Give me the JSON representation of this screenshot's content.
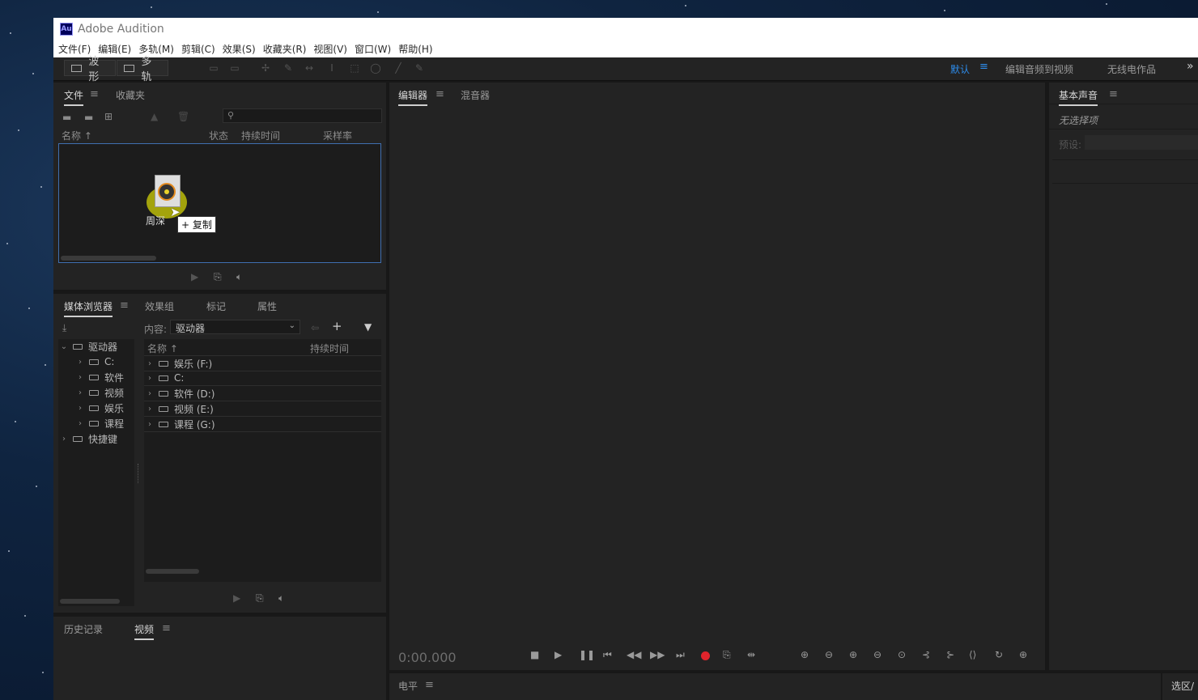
{
  "app": {
    "logo": "Au",
    "title": "Adobe Audition"
  },
  "menu": [
    "文件(F)",
    "编辑(E)",
    "多轨(M)",
    "剪辑(C)",
    "效果(S)",
    "收藏夹(R)",
    "视图(V)",
    "窗口(W)",
    "帮助(H)"
  ],
  "toolbar": {
    "waveform_label": "波形",
    "multitrack_label": "多轨"
  },
  "workspaces": {
    "default": "默认",
    "edit_audio_to_video": "编辑音频到视频",
    "radio": "无线电作品",
    "more": "»"
  },
  "files_panel": {
    "tabs": [
      "文件",
      "收藏夹"
    ],
    "columns": {
      "name": "名称 ↑",
      "status": "状态",
      "duration": "持续时间",
      "sample_rate": "采样率"
    },
    "dragged_file_label": "周深",
    "copy_tooltip": "+ 复制"
  },
  "media_panel": {
    "tabs": [
      "媒体浏览器",
      "效果组",
      "标记",
      "属性"
    ],
    "content_label": "内容:",
    "content_value": "驱动器",
    "tree": {
      "root": "驱动器",
      "items": [
        "C:",
        "软件",
        "视频",
        "娱乐",
        "课程"
      ],
      "shortcuts": "快捷键"
    },
    "columns": {
      "name": "名称 ↑",
      "duration": "持续时间"
    },
    "list": [
      "娱乐 (F:)",
      "C:",
      "软件 (D:)",
      "视频 (E:)",
      "课程 (G:)"
    ]
  },
  "bottom_left_panel": {
    "tabs": [
      "历史记录",
      "视频"
    ]
  },
  "editor_panel": {
    "tabs": [
      "编辑器",
      "混音器"
    ],
    "time": "0:00.000"
  },
  "essential_sound": {
    "title": "基本声音",
    "no_selection": "无选择项",
    "preset_label": "预设:"
  },
  "level_panel": {
    "title": "电平"
  },
  "selection_panel": {
    "title": "选区/"
  },
  "colors": {
    "accent": "#2d8ceb",
    "record": "#e0242c",
    "panel": "#232323",
    "background": "#181818"
  }
}
